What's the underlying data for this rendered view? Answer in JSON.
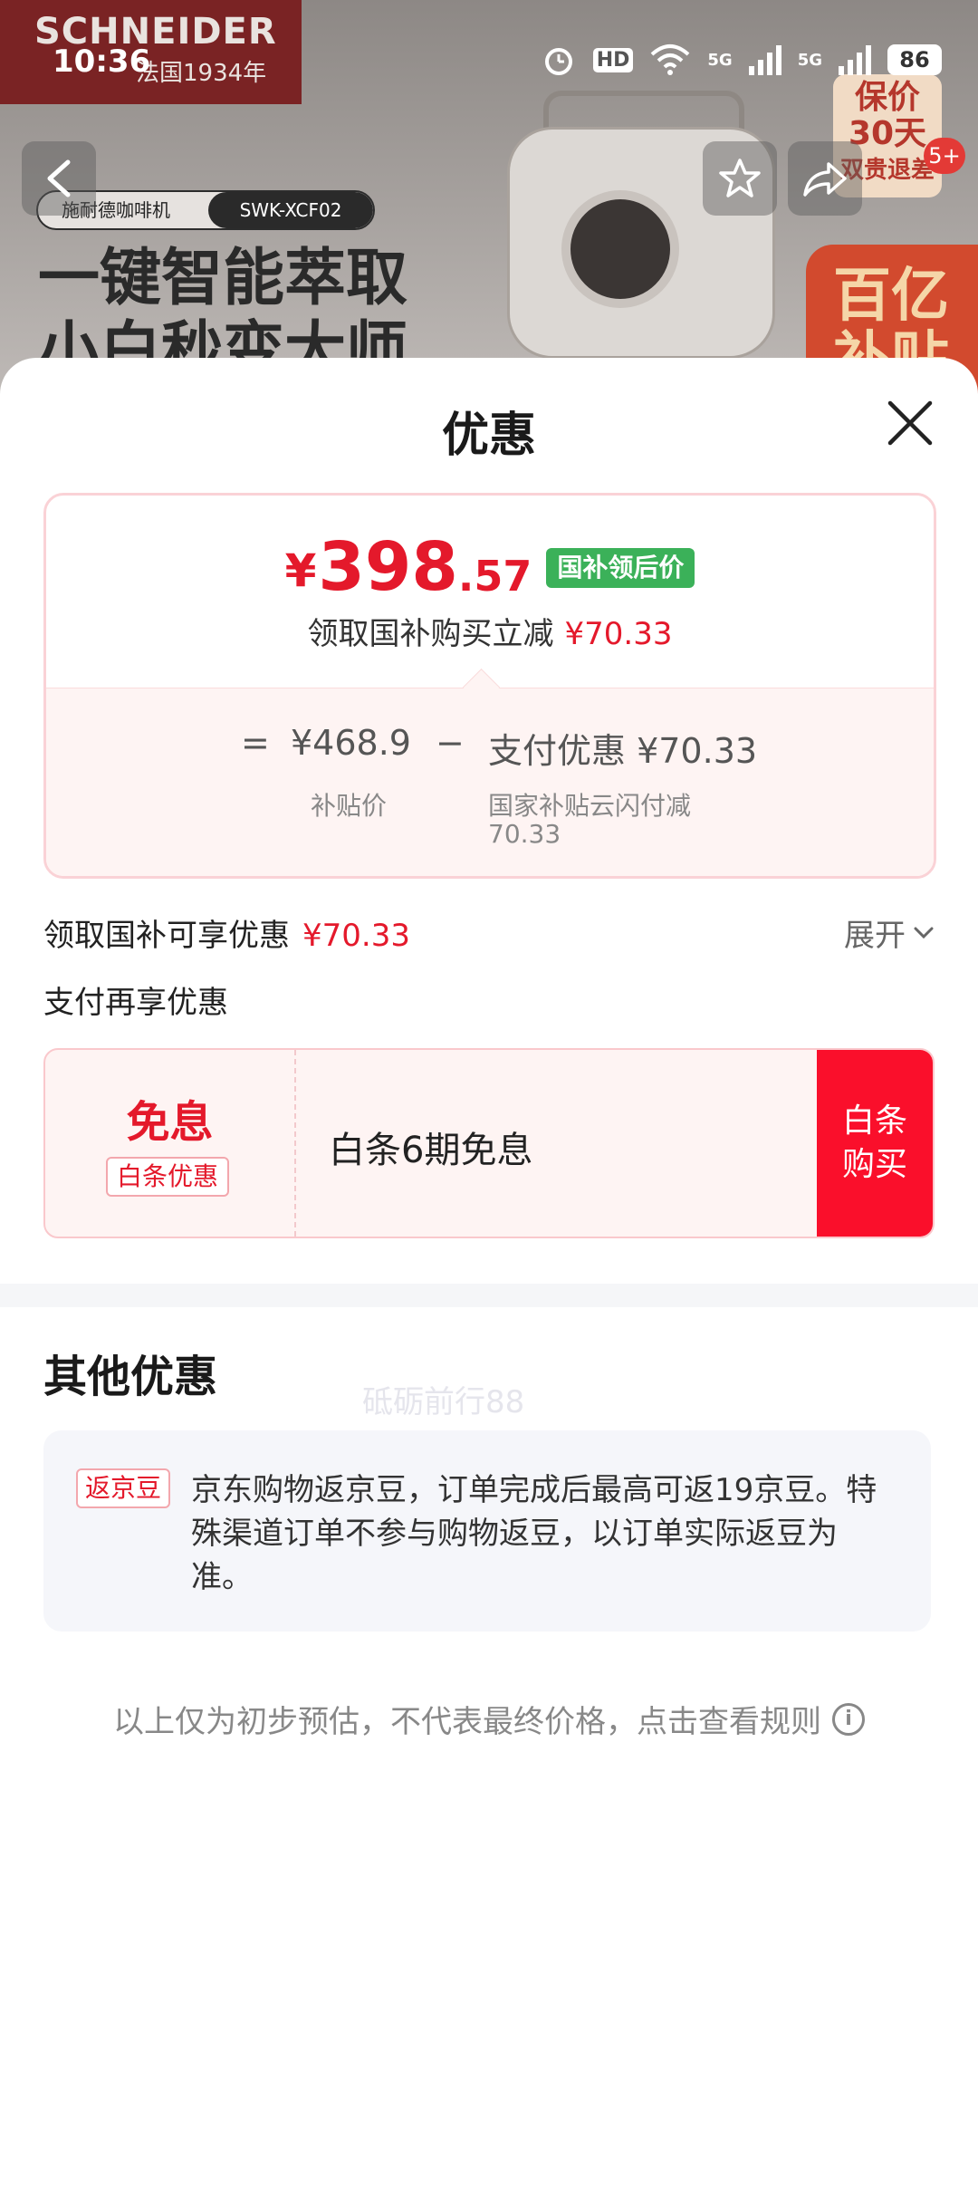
{
  "status_bar": {
    "time": "10:36",
    "hd_label": "HD",
    "net1": "5G",
    "net2": "5G",
    "battery": "86"
  },
  "backdrop": {
    "brand": "SCHNEIDER",
    "brand_sub": "法国1934年",
    "product_left": "施耐德咖啡机",
    "product_model": "SWK-XCF02",
    "headline": "一键智能萃取",
    "headline2": "小白秒变大师",
    "promo_line1": "保价",
    "promo_line2": "30天",
    "promo_line3": "双贵退差",
    "promo_badge": "5+",
    "promo_red1": "百亿",
    "promo_red2": "补贴"
  },
  "sheet": {
    "title": "优惠",
    "price_card": {
      "currency": "¥",
      "price_int": "398",
      "price_dec": ".57",
      "tag": "国补领后价",
      "subline": "领取国补购买立减",
      "subline_amount": "¥70.33",
      "eq": "=",
      "base_price": "¥468.9",
      "base_label": "补贴价",
      "minus": "−",
      "pay_discount": "支付优惠 ¥70.33",
      "pay_label_1": "国家补贴云闪付减",
      "pay_label_2": "70.33"
    },
    "claim_line": "领取国补可享优惠",
    "claim_amount": "¥70.33",
    "expand": "展开",
    "pay_line": "支付再享优惠",
    "watermark": "砥砺前行88",
    "baitiao": {
      "main": "免息",
      "tag": "白条优惠",
      "text": "白条6期免息",
      "btn_line1": "白条",
      "btn_line2": "购买"
    },
    "other": {
      "title": "其他优惠",
      "tag": "返京豆",
      "text": "京东购物返京豆，订单完成后最高可返19京豆。特殊渠道订单不参与购物返豆，以订单实际返豆为准。"
    },
    "footer": "以上仅为初步预估，不代表最终价格，点击查看规则",
    "info_icon_glyph": "i"
  }
}
